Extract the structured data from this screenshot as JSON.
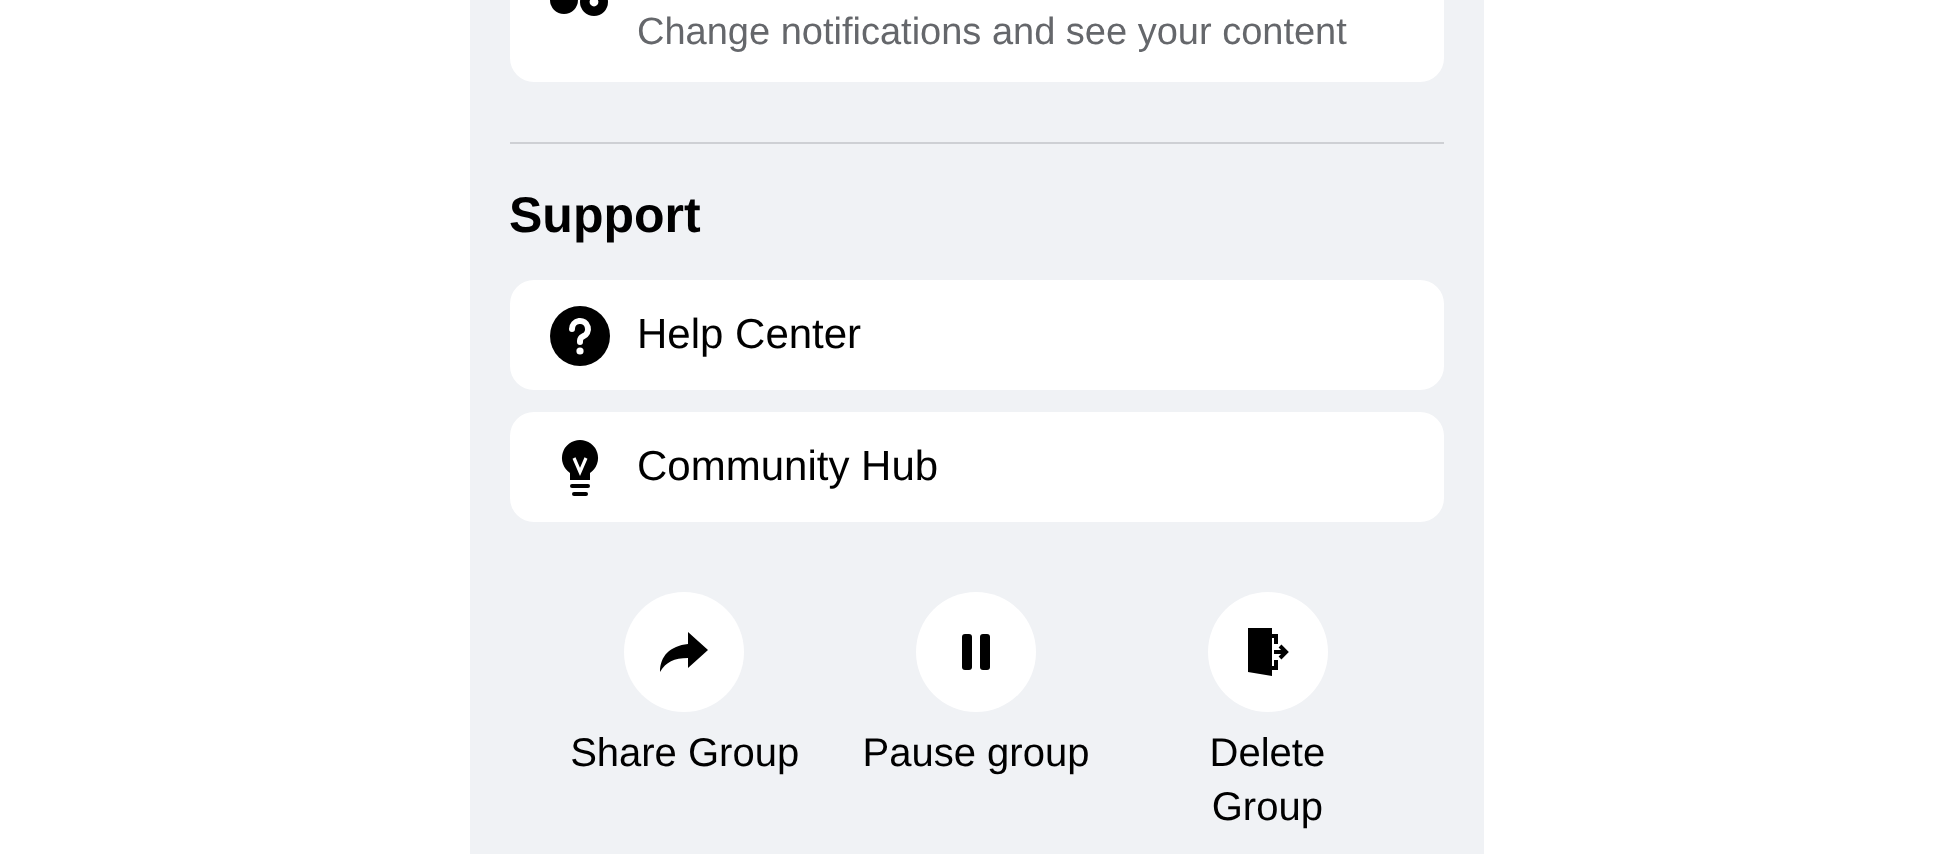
{
  "settings_card": {
    "subtitle": "Change notifications and see your content"
  },
  "support": {
    "heading": "Support",
    "items": [
      {
        "kind": "help",
        "label": "Help Center"
      },
      {
        "kind": "bulb",
        "label": "Community Hub"
      }
    ]
  },
  "actions": [
    {
      "kind": "share",
      "label": "Share Group"
    },
    {
      "kind": "pause",
      "label": "Pause group"
    },
    {
      "kind": "leave",
      "label": "Delete Group"
    }
  ]
}
